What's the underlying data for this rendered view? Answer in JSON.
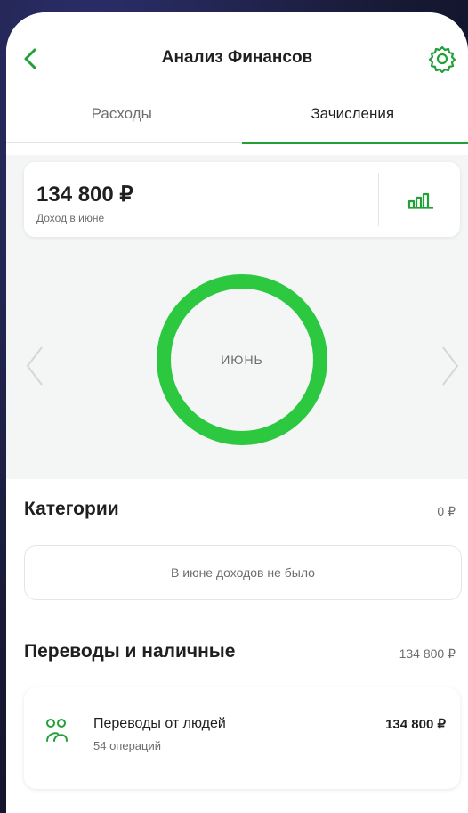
{
  "header": {
    "title": "Анализ Финансов"
  },
  "tabs": [
    {
      "label": "Расходы",
      "active": false
    },
    {
      "label": "Зачисления",
      "active": true
    }
  ],
  "summary": {
    "amount": "134 800 ₽",
    "label": "Доход в июне"
  },
  "donut": {
    "month": "ИЮНЬ",
    "color": "#2bc840",
    "filled_fraction": 1.0
  },
  "categories": {
    "title": "Категории",
    "total": "0 ₽",
    "empty_message": "В июне доходов не было"
  },
  "transfers": {
    "title": "Переводы и наличные",
    "total": "134 800 ₽",
    "items": [
      {
        "name": "Переводы от людей",
        "count": "54 операций",
        "amount": "134 800 ₽",
        "icon": "people-icon"
      }
    ]
  },
  "colors": {
    "accent": "#21a038"
  }
}
